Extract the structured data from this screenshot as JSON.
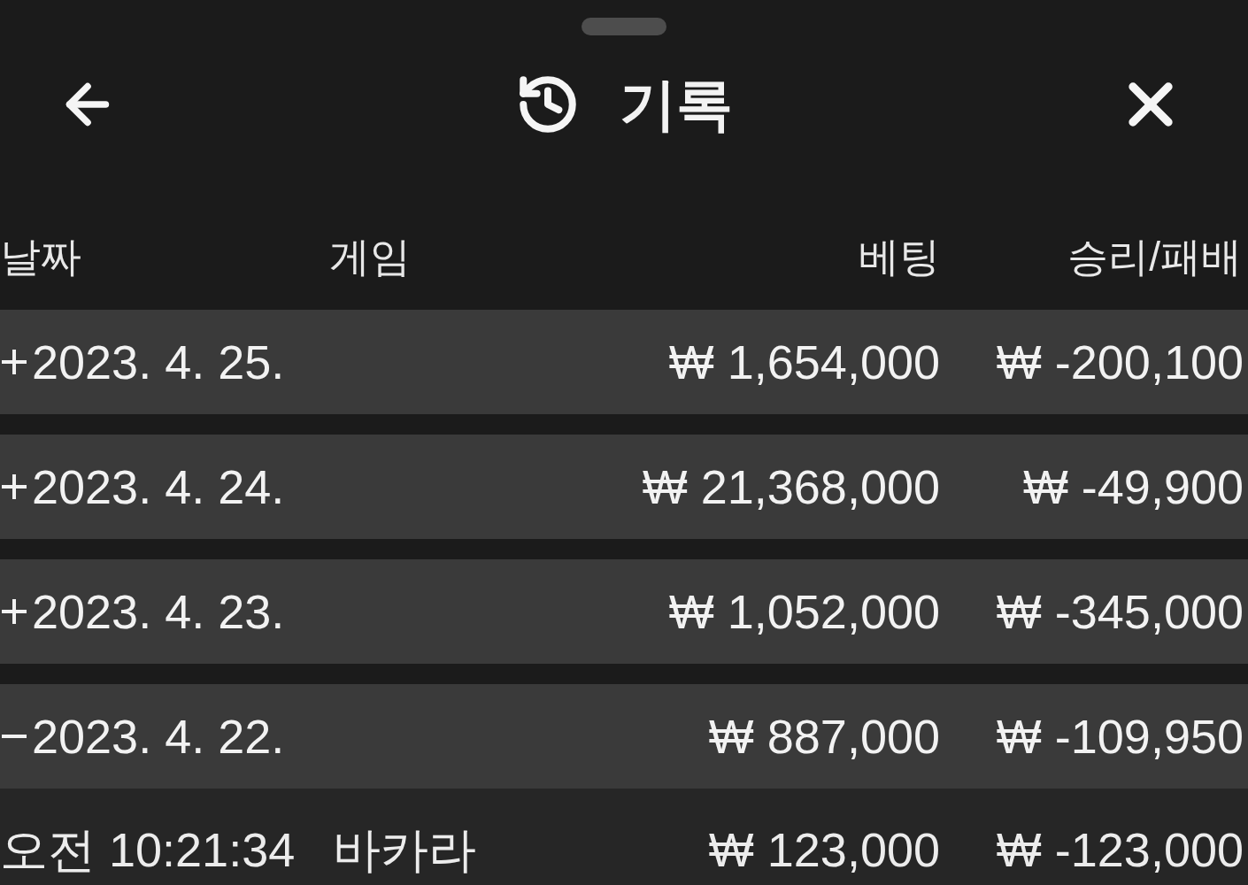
{
  "sheet": {
    "title": "기록"
  },
  "table": {
    "columns": [
      "날짜",
      "게임",
      "베팅",
      "승리/패배"
    ],
    "groups": [
      {
        "date": "2023. 4. 25.",
        "expanded": false,
        "bet": "₩ 1,654,000",
        "result": "₩ -200,100"
      },
      {
        "date": "2023. 4. 24.",
        "expanded": false,
        "bet": "₩ 21,368,000",
        "result": "₩ -49,900"
      },
      {
        "date": "2023. 4. 23.",
        "expanded": false,
        "bet": "₩ 1,052,000",
        "result": "₩ -345,000"
      },
      {
        "date": "2023. 4. 22.",
        "expanded": true,
        "bet": "₩ 887,000",
        "result": "₩ -109,950",
        "children": [
          {
            "time": "오전 10:21:34",
            "game": "바카라",
            "bet": "₩ 123,000",
            "result": "₩ -123,000"
          }
        ]
      }
    ]
  }
}
